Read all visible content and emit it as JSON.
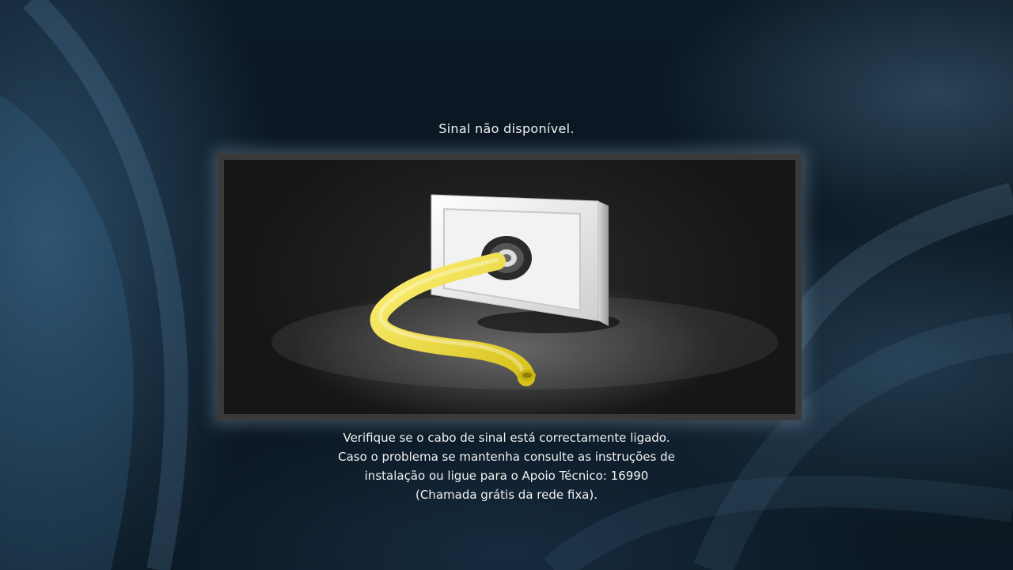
{
  "screen": {
    "title": "Sinal não disponível.",
    "message_lines": [
      "Verifique se o cabo de sinal está correctamente ligado.",
      "Caso o problema se mantenha consulte as instruções de",
      "instalação ou ligue para o Apoio Técnico: 16990",
      "(Chamada grátis da rede fixa)."
    ]
  },
  "illustration": {
    "icon": "antenna-wall-socket-with-cable-icon",
    "cable_color": "#f2e23a",
    "socket_color": "#eeeeee"
  },
  "colors": {
    "background": "#0b1823",
    "text": "#f2f2f2",
    "frame": "#3a3a3a"
  }
}
